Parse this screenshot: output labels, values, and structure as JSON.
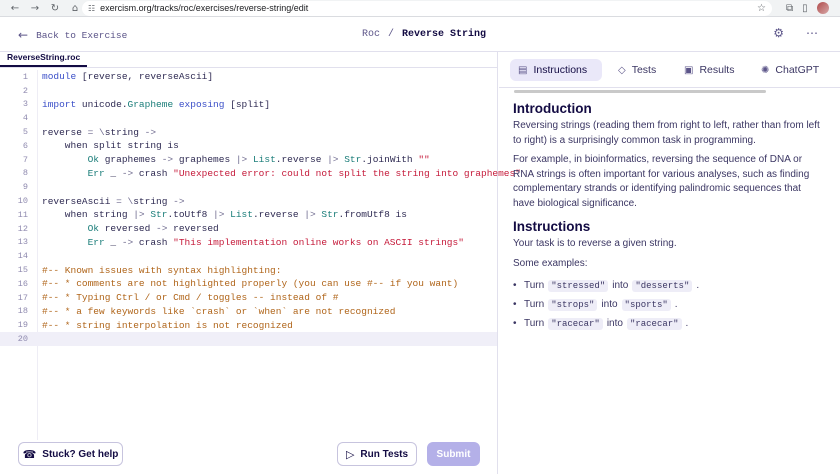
{
  "browser": {
    "url": "exercism.org/tracks/roc/exercises/reverse-string/edit",
    "icons": [
      "back-icon",
      "forward-icon",
      "reload-icon",
      "home-icon",
      "site-settings-icon",
      "star-icon",
      "extensions-icon",
      "sidebar-icon",
      "profile-avatar",
      "menu-icon"
    ]
  },
  "header": {
    "back_label": "Back to Exercise",
    "track": "Roc",
    "separator": "/",
    "exercise": "Reverse String"
  },
  "editor": {
    "file_name": "ReverseString.roc",
    "lines": [
      "module [reverse, reverseAscii]",
      "",
      "import unicode.Grapheme exposing [split]",
      "",
      "reverse = \\string ->",
      "    when split string is",
      "        Ok graphemes -> graphemes |> List.reverse |> Str.joinWith \"\"",
      "        Err _ -> crash \"Unexpected error: could not split the string into graphemes\"",
      "",
      "reverseAscii = \\string ->",
      "    when string |> Str.toUtf8 |> List.reverse |> Str.fromUtf8 is",
      "        Ok reversed -> reversed",
      "        Err _ -> crash \"This implementation online works on ASCII strings\"",
      "",
      "#-- Known issues with syntax highlighting:",
      "#-- * comments are not highlighted properly (you can use #-- if you want)",
      "#-- * Typing Ctrl / or Cmd / toggles -- instead of #",
      "#-- * a few keywords like `crash` or `when` are not recognized",
      "#-- * string interpolation is not recognized",
      ""
    ],
    "active_line": 20,
    "stuck_label": "Stuck? Get help",
    "run_label": "Run Tests",
    "submit_label": "Submit"
  },
  "tabs": [
    {
      "label": "Instructions",
      "active": true
    },
    {
      "label": "Tests",
      "active": false
    },
    {
      "label": "Results",
      "active": false
    },
    {
      "label": "ChatGPT",
      "active": false
    }
  ],
  "instructions": {
    "intro_title": "Introduction",
    "intro_p1": "Reversing strings (reading them from right to left, rather than from left to right) is a surprisingly common task in programming.",
    "intro_p2": "For example, in bioinformatics, reversing the sequence of DNA or RNA strings is often important for various analyses, such as finding complementary strands or identifying palindromic sequences that have biological significance.",
    "title": "Instructions",
    "task": "Your task is to reverse a given string.",
    "examples_label": "Some examples:",
    "examples": [
      {
        "turn": "Turn",
        "input": "\"stressed\"",
        "into": "into",
        "output": "\"desserts\"",
        "end": "."
      },
      {
        "turn": "Turn",
        "input": "\"strops\"",
        "into": "into",
        "output": "\"sports\"",
        "end": "."
      },
      {
        "turn": "Turn",
        "input": "\"racecar\"",
        "into": "into",
        "output": "\"racecar\"",
        "end": "."
      }
    ]
  }
}
